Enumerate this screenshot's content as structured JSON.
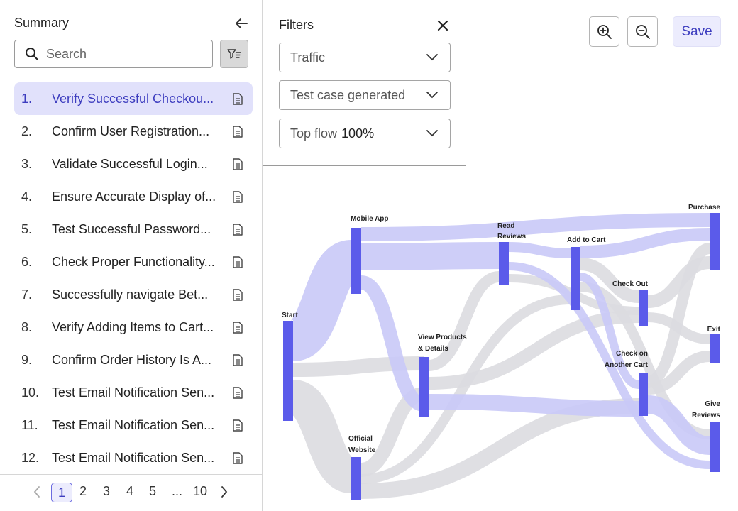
{
  "sidebar": {
    "title": "Summary",
    "search_placeholder": "Search",
    "items": [
      {
        "num": "1.",
        "label": "Verify Successful Checkou..."
      },
      {
        "num": "2.",
        "label": "Confirm User Registration..."
      },
      {
        "num": "3.",
        "label": "Validate Successful Login..."
      },
      {
        "num": "4.",
        "label": "Ensure Accurate Display of..."
      },
      {
        "num": "5.",
        "label": "Test Successful Password..."
      },
      {
        "num": "6.",
        "label": "Check Proper Functionality..."
      },
      {
        "num": "7.",
        "label": "Successfully navigate Bet..."
      },
      {
        "num": "8.",
        "label": "Verify Adding Items to Cart..."
      },
      {
        "num": "9.",
        "label": "Confirm Order History Is A..."
      },
      {
        "num": "10.",
        "label": "Test Email Notification Sen..."
      },
      {
        "num": "11.",
        "label": "Test Email Notification Sen..."
      },
      {
        "num": "12.",
        "label": "Test Email Notification Sen..."
      }
    ],
    "selected_index": 0
  },
  "pagination": {
    "pages": [
      "1",
      "2",
      "3",
      "4",
      "5",
      "...",
      "10"
    ],
    "current": "1"
  },
  "filters": {
    "title": "Filters",
    "traffic": "Traffic",
    "test_case": "Test case generated",
    "top_flow_label": "Top flow",
    "top_flow_value": "100%"
  },
  "toolbar": {
    "save_label": "Save"
  },
  "sankey": {
    "nodes": {
      "start": "Start",
      "mobile_app": "Mobile App",
      "official_website_1": "Official",
      "official_website_2": "Website",
      "read_reviews_1": "Read",
      "read_reviews_2": "Reviews",
      "view_products_1": "View Products",
      "view_products_2": "& Details",
      "add_to_cart": "Add to Cart",
      "check_out": "Check Out",
      "check_another_1": "Check on",
      "check_another_2": "Another Cart",
      "purchase": "Purchase",
      "exit": "Exit",
      "give_reviews_1": "Give",
      "give_reviews_2": "Reviews"
    }
  },
  "colors": {
    "accent": "#5b5bea",
    "link_highlight": "#c9c9f7",
    "link_gray": "#dcdce0",
    "selected_bg": "#e1e1fb"
  }
}
